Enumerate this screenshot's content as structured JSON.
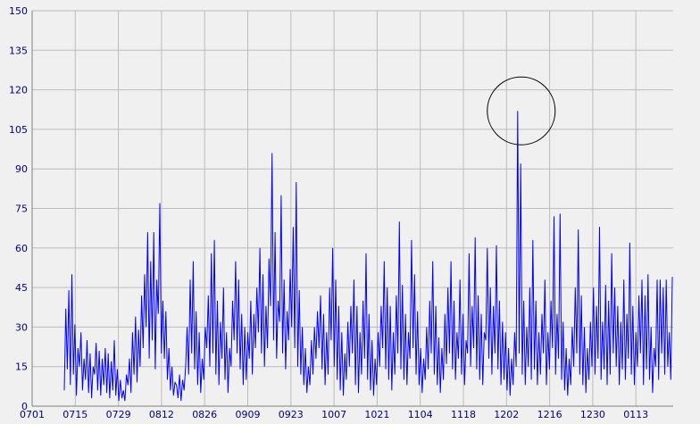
{
  "chart_data": {
    "type": "line",
    "title": "",
    "xlabel": "",
    "ylabel": "",
    "ylim": [
      0,
      150
    ],
    "y_ticks": [
      0,
      15,
      30,
      45,
      60,
      75,
      90,
      105,
      120,
      135,
      150
    ],
    "x_tick_labels": [
      "0701",
      "0715",
      "0729",
      "0812",
      "0826",
      "0909",
      "0923",
      "1007",
      "1021",
      "1104",
      "1118",
      "1202",
      "1216",
      "1230",
      "0113"
    ],
    "grid": true,
    "colors": {
      "line": "#0000ff",
      "grid": "#bcbcbc",
      "axis_text": "#000080",
      "background": "#f0f0f0"
    },
    "series": [
      {
        "values": [
          6,
          37,
          14,
          44,
          8,
          50,
          12,
          31,
          4,
          22,
          15,
          28,
          6,
          18,
          10,
          25,
          5,
          20,
          3,
          15,
          12,
          24,
          6,
          21,
          4,
          18,
          8,
          22,
          5,
          20,
          3,
          17,
          6,
          25,
          4,
          14,
          2,
          10,
          3,
          6,
          2,
          12,
          8,
          18,
          5,
          28,
          12,
          34,
          9,
          29,
          15,
          42,
          22,
          50,
          30,
          66,
          18,
          55,
          25,
          66,
          14,
          48,
          35,
          77,
          20,
          40,
          18,
          36,
          10,
          22,
          6,
          15,
          4,
          9,
          8,
          3,
          12,
          2,
          10,
          6,
          15,
          30,
          12,
          48,
          20,
          55,
          14,
          36,
          8,
          28,
          5,
          18,
          10,
          30,
          22,
          42,
          15,
          58,
          20,
          63,
          12,
          40,
          8,
          32,
          18,
          45,
          10,
          28,
          5,
          22,
          15,
          40,
          25,
          55,
          20,
          48,
          14,
          35,
          8,
          30,
          10,
          28,
          18,
          40,
          12,
          35,
          22,
          45,
          28,
          60,
          20,
          50,
          15,
          38,
          22,
          56,
          38,
          96,
          25,
          66,
          18,
          40,
          32,
          80,
          20,
          48,
          14,
          36,
          25,
          52,
          30,
          68,
          22,
          85,
          15,
          44,
          12,
          30,
          8,
          22,
          5,
          15,
          8,
          25,
          12,
          30,
          18,
          36,
          22,
          42,
          14,
          35,
          8,
          28,
          12,
          45,
          25,
          60,
          15,
          48,
          10,
          38,
          6,
          28,
          4,
          20,
          10,
          32,
          15,
          38,
          20,
          48,
          8,
          38,
          5,
          28,
          12,
          40,
          18,
          58,
          10,
          35,
          6,
          25,
          4,
          18,
          8,
          28,
          15,
          38,
          22,
          55,
          14,
          45,
          10,
          38,
          6,
          28,
          12,
          42,
          20,
          70,
          14,
          46,
          10,
          35,
          8,
          28,
          18,
          63,
          22,
          50,
          12,
          36,
          8,
          22,
          5,
          18,
          10,
          30,
          14,
          40,
          20,
          55,
          12,
          38,
          8,
          26,
          5,
          22,
          10,
          35,
          16,
          45,
          20,
          55,
          14,
          40,
          10,
          28,
          18,
          48,
          12,
          35,
          8,
          25,
          20,
          58,
          15,
          38,
          22,
          64,
          14,
          42,
          10,
          35,
          8,
          28,
          25,
          60,
          18,
          45,
          12,
          38,
          20,
          61,
          14,
          40,
          8,
          32,
          10,
          28,
          6,
          22,
          4,
          18,
          8,
          28,
          15,
          112,
          20,
          92,
          12,
          40,
          8,
          30,
          15,
          45,
          10,
          63,
          14,
          40,
          8,
          28,
          12,
          35,
          20,
          48,
          8,
          28,
          14,
          40,
          22,
          72,
          12,
          35,
          18,
          73,
          10,
          32,
          6,
          22,
          4,
          18,
          8,
          30,
          15,
          45,
          20,
          67,
          12,
          42,
          8,
          30,
          5,
          22,
          10,
          32,
          15,
          45,
          12,
          38,
          18,
          68,
          10,
          32,
          14,
          46,
          8,
          40,
          12,
          58,
          20,
          45,
          15,
          38,
          8,
          32,
          14,
          48,
          10,
          35,
          18,
          62,
          12,
          38,
          8,
          28,
          15,
          42,
          20,
          48,
          8,
          42,
          14,
          50,
          10,
          30,
          5,
          22,
          15,
          48,
          10,
          48,
          20,
          45,
          12,
          48,
          15,
          28,
          10,
          49
        ]
      }
    ],
    "annotations": [
      {
        "type": "circle",
        "description": "highlighted peak",
        "value": 112
      }
    ]
  }
}
